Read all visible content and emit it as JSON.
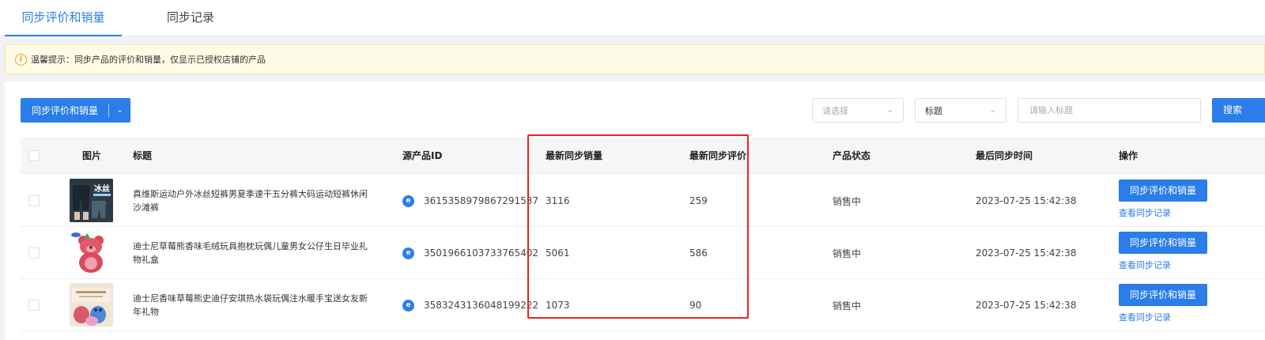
{
  "tabs": [
    {
      "label": "同步评价和销量",
      "active": true
    },
    {
      "label": "同步记录",
      "active": false
    }
  ],
  "notice": {
    "icon": "info-icon",
    "text": "温馨提示：同步产品的评价和销量，仅显示已授权店铺的产品"
  },
  "toolbar": {
    "sync_label": "同步评价和销量",
    "select1": "请选择",
    "select2": "标题",
    "search_placeholder": "请输入标题",
    "search_label": "搜索"
  },
  "table": {
    "headers": {
      "image": "图片",
      "title": "标题",
      "source_id": "源产品ID",
      "sales": "最新同步销量",
      "reviews": "最新同步评价",
      "status": "产品状态",
      "time": "最后同步时间",
      "ops": "操作"
    },
    "rows": [
      {
        "title": "真维斯运动户外冰丝短裤男夏季速干五分裤大码运动短裤休闲沙滩裤",
        "source_id": "3615358979867291537",
        "sales": "3116",
        "reviews": "259",
        "status": "销售中",
        "time": "2023-07-25 15:42:38",
        "thumb_text": "冰丝",
        "op_button": "同步评价和销量",
        "op_link": "查看同步记录"
      },
      {
        "title": "迪士尼草莓熊香味毛绒玩具抱枕玩偶儿童男女公仔生日毕业礼物礼盒",
        "source_id": "3501966103733765402",
        "sales": "5061",
        "reviews": "586",
        "status": "销售中",
        "time": "2023-07-25 15:42:38",
        "op_button": "同步评价和销量",
        "op_link": "查看同步记录"
      },
      {
        "title": "迪士尼香味草莓熊史迪仔安琪热水袋玩偶注水暖手宝送女友新年礼物",
        "source_id": "3583243136048199222",
        "sales": "1073",
        "reviews": "90",
        "status": "销售中",
        "time": "2023-07-25 15:42:38",
        "op_button": "同步评价和销量",
        "op_link": "查看同步记录"
      }
    ]
  },
  "colors": {
    "accent": "#2b7de9",
    "highlight": "#e5251d",
    "notice_bg": "#fefbe6"
  }
}
